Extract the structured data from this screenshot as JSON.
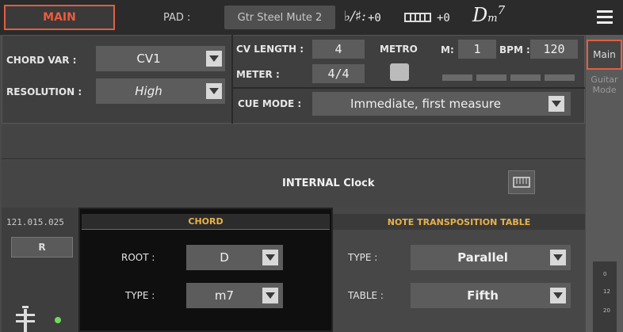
{
  "topbar": {
    "main_tab": "MAIN",
    "pad_label": "PAD :",
    "pad_value": "Gtr Steel Mute 2",
    "accidental_label": "♭/♯:",
    "accidental_value": "+0",
    "keyboard_value": "+0",
    "chord_display": "D",
    "chord_display_suffix": "m",
    "chord_display_super": "7"
  },
  "side_tabs": {
    "main": "Main",
    "guitar_line1": "Guitar",
    "guitar_line2": "Mode",
    "scale": [
      "0",
      "12",
      "20"
    ]
  },
  "top_panel": {
    "chord_var_label": "CHORD VAR :",
    "chord_var_value": "CV1",
    "resolution_label": "RESOLUTION :",
    "resolution_value": "High",
    "cv_length_label": "CV LENGTH :",
    "cv_length_value": "4",
    "meter_label": "METER :",
    "meter_value": "4/4",
    "metro_label": "METRO",
    "m_label": "M:",
    "m_value": "1",
    "bpm_label": "BPM :",
    "bpm_value": "120",
    "cue_mode_label": "CUE MODE :",
    "cue_mode_value": "Immediate, first measure"
  },
  "clock": {
    "text": "INTERNAL Clock"
  },
  "bottom_left": {
    "position": "121.015.025",
    "r_button": "R"
  },
  "chord_panel": {
    "title": "CHORD",
    "root_label": "ROOT :",
    "root_value": "D",
    "type_label": "TYPE :",
    "type_value": "m7"
  },
  "ntt_panel": {
    "title": "NOTE TRANSPOSITION TABLE",
    "type_label": "TYPE :",
    "type_value": "Parallel",
    "table_label": "TABLE :",
    "table_value": "Fifth"
  },
  "colors": {
    "accent": "#f05a3c",
    "section_title": "#e8b24a",
    "led": "#6fdc5c"
  }
}
